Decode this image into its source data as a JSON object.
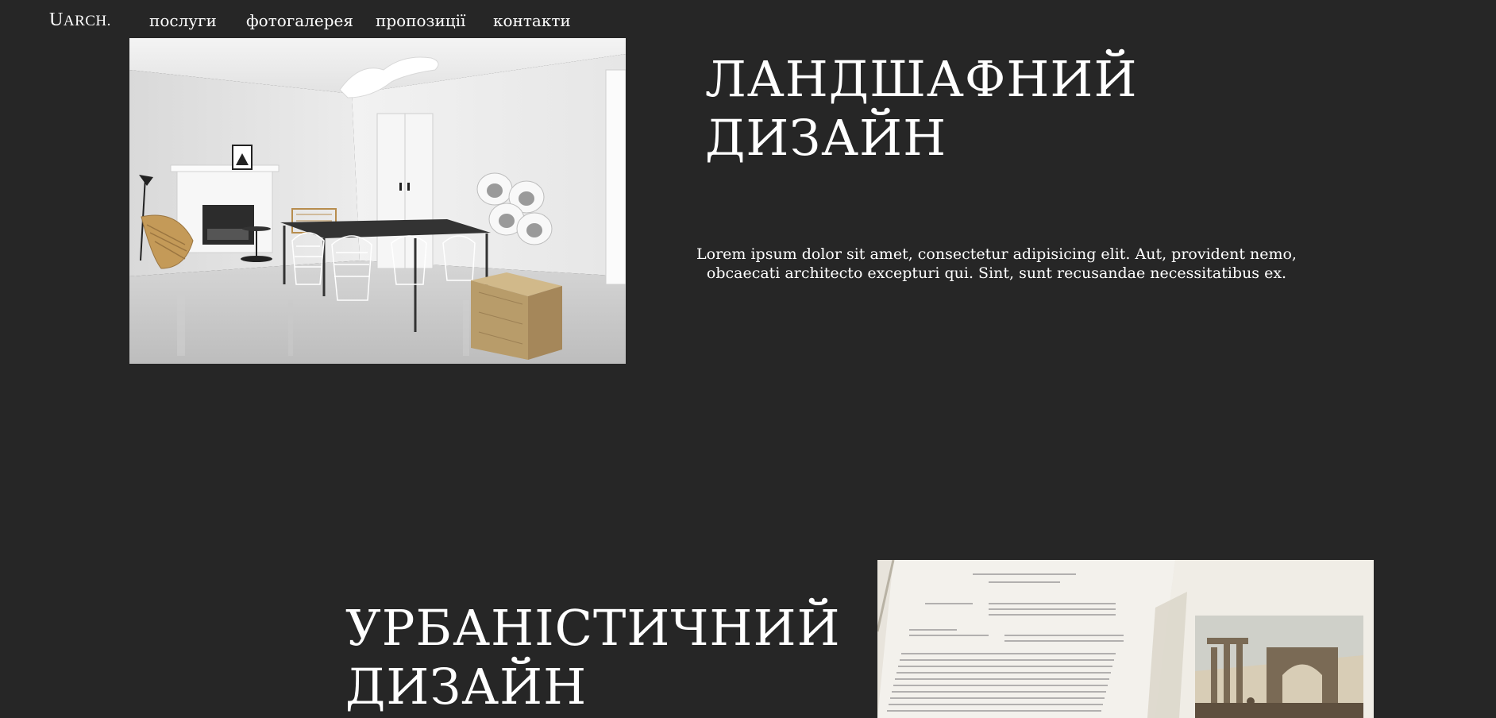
{
  "nav": {
    "logo_big": "U",
    "logo_rest": "ARCH.",
    "links": [
      "послуги",
      "фотогалерея",
      "пропозиції",
      "контакти"
    ]
  },
  "section1": {
    "title_line1": "ЛАНДШАФНИЙ",
    "title_line2": "ДИЗАЙН",
    "text": "Lorem ipsum dolor sit amet, consectetur adipisicing elit. Aut, provident nemo, obcaecati architecto excepturi qui. Sint, sunt recusandae necessitatibus ex."
  },
  "section2": {
    "title_line1": "УРБАНІСТИЧНИЙ",
    "title_line2": "ДИЗАЙН"
  },
  "colors": {
    "background": "#262626",
    "text": "#ffffff"
  }
}
